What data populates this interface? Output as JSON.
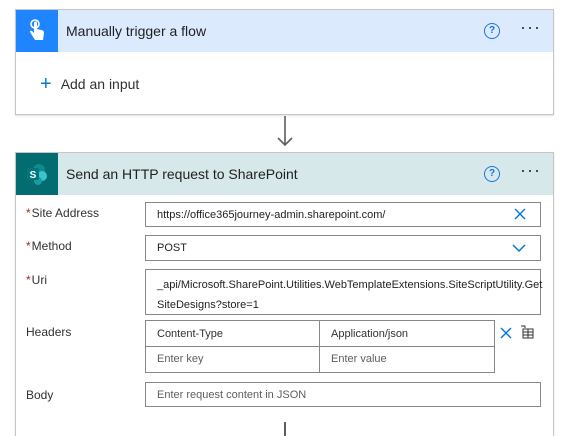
{
  "trigger": {
    "title": "Manually trigger a flow",
    "add_input_label": "Add an input",
    "accent_color": "#1f85ff"
  },
  "action": {
    "title": "Send an HTTP request to SharePoint",
    "accent_color": "#036c70",
    "fields": {
      "site_address": {
        "label": "Site Address",
        "required": "*",
        "value": "https://office365journey-admin.sharepoint.com/"
      },
      "method": {
        "label": "Method",
        "required": "*",
        "value": "POST"
      },
      "uri": {
        "label": "Uri",
        "required": "*",
        "value_line1": "_api/Microsoft.SharePoint.Utilities.WebTemplateExtensions.SiteScriptUtility.Get",
        "value_line2": "SiteDesigns?store=1"
      },
      "headers": {
        "label": "Headers",
        "key": "Content-Type",
        "value": "Application/json",
        "key_placeholder": "Enter key",
        "value_placeholder": "Enter value"
      },
      "body": {
        "label": "Body",
        "placeholder": "Enter request content in JSON"
      }
    }
  },
  "icons": {
    "help": "?",
    "more": "···",
    "plus": "+"
  }
}
